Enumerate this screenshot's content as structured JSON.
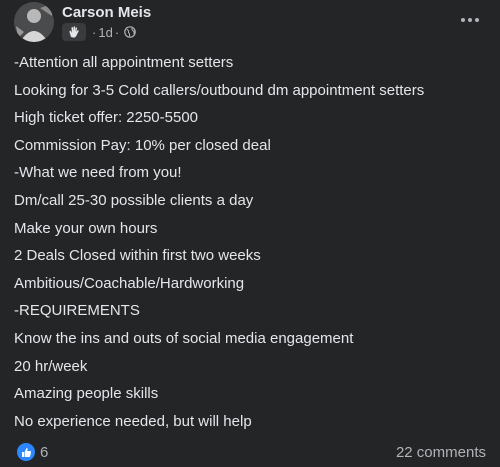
{
  "post": {
    "author": "Carson Meis",
    "timestamp": "1d",
    "separator": "·",
    "badge_icon": "wave-hand-icon",
    "audience_icon": "globe-icon",
    "more_icon": "more-options-icon",
    "body_lines": [
      "-Attention all appointment setters",
      "Looking for 3-5 Cold callers/outbound dm appointment setters",
      "High ticket offer: 2250-5500",
      "Commission Pay: 10% per closed deal",
      "-What we need from you!",
      "Dm/call 25-30 possible clients a day",
      "Make your own hours",
      "2 Deals Closed within first two weeks",
      "Ambitious/Coachable/Hardworking",
      "-REQUIREMENTS",
      "Know the ins and outs of social media engagement",
      "20 hr/week",
      "Amazing people skills",
      "No experience needed, but will help"
    ],
    "reactions": {
      "icon": "like-icon",
      "count": "6"
    },
    "comments_label": "22 comments"
  },
  "colors": {
    "background": "#242526",
    "primary_text": "#e4e6eb",
    "secondary_text": "#b0b3b8",
    "like_blue": "#2d88ff"
  }
}
